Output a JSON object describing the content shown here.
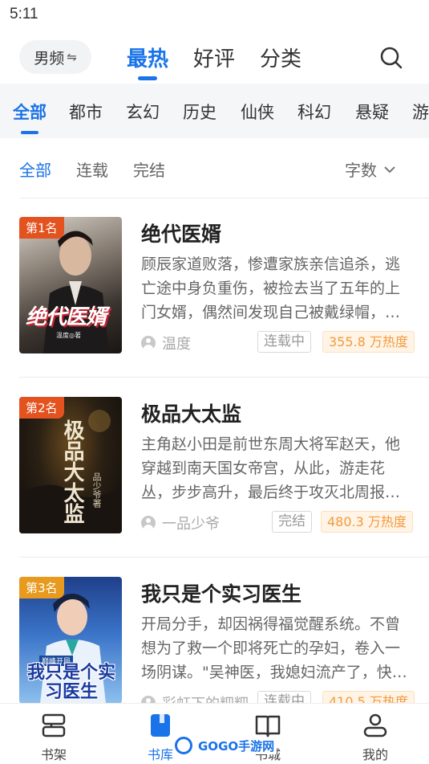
{
  "status_bar": {
    "time": "5:11"
  },
  "top_nav": {
    "gender": "男频",
    "gender_icon": "swap-icon",
    "tabs": [
      {
        "label": "最热",
        "active": true
      },
      {
        "label": "好评",
        "active": false
      },
      {
        "label": "分类",
        "active": false
      }
    ],
    "search_icon": "search-icon"
  },
  "categories": [
    "全部",
    "都市",
    "玄幻",
    "历史",
    "仙侠",
    "科幻",
    "悬疑",
    "游"
  ],
  "filters": {
    "options": [
      "全部",
      "连载",
      "完结"
    ],
    "sort_label": "字数"
  },
  "books": [
    {
      "rank": "第1名",
      "cover_text": "绝代医婿",
      "cover_author": "温度◎著",
      "title": "绝代医婿",
      "description": "顾辰家道败落，惨遭家族亲信追杀，逃亡途中身负重伤，被捡去当了五年的上门女婿，偶然间发现自己被戴绿帽，…",
      "author": "温度",
      "status": "连载中",
      "heat": "355.8 万热度"
    },
    {
      "rank": "第2名",
      "cover_text": "极品大太监",
      "cover_author": "品少爷著",
      "title": "极品大太监",
      "description": "主角赵小田是前世东周大将军赵天，他穿越到南天国女帝宫，从此，游走花丛，步步高升，最后终于攻灭北周报…",
      "author": "一品少爷",
      "status": "完结",
      "heat": "480.3 万热度"
    },
    {
      "rank": "第3名",
      "cover_text": "我只是个实习医生",
      "cover_author": "巅峰开局",
      "title": "我只是个实习医生",
      "description": "开局分手，却因祸得福觉醒系统。不曾想为了救一个即将死亡的孕妇，卷入一场阴谋。\"吴神医，我媳妇流产了，快…",
      "author": "彩虹下的粑粑",
      "status": "连载中",
      "heat": "410.5 万热度"
    }
  ],
  "bottom_nav": [
    {
      "label": "书架",
      "icon": "bookshelf-icon",
      "active": false
    },
    {
      "label": "书库",
      "icon": "library-icon",
      "active": true
    },
    {
      "label": "书城",
      "icon": "open-book-icon",
      "active": false
    },
    {
      "label": "我的",
      "icon": "profile-icon",
      "active": false
    }
  ],
  "watermark": "GOGO手游网",
  "colors": {
    "accent": "#1a73e8",
    "heat": "#f39a3d",
    "rank_badge": "#e4531f",
    "rank_badge_3": "#e89a1f"
  }
}
